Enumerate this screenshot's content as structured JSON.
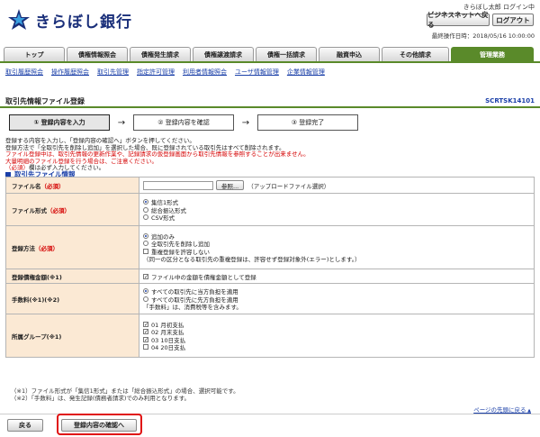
{
  "header": {
    "bank_name": "きらぼし銀行",
    "user_status": "きらぼし太郎 ログイン中",
    "biz_net_button": "ビジネスネットへ戻る",
    "logout_button": "ログアウト",
    "last_operation": "最終操作日時：2018/05/16 10:00:00",
    "brand_color": "#1a2f7a",
    "accent_color": "#5a8a2a"
  },
  "tabs": [
    {
      "label": "トップ",
      "w": 68
    },
    {
      "label": "債権情報照会",
      "w": 68
    },
    {
      "label": "債権発生請求",
      "w": 68
    },
    {
      "label": "債権譲渡請求",
      "w": 68
    },
    {
      "label": "債権一括請求",
      "w": 68
    },
    {
      "label": "融資申込",
      "w": 68
    },
    {
      "label": "その他請求",
      "w": 75
    },
    {
      "label": "管理業務",
      "w": 92,
      "active": true
    }
  ],
  "subnav": [
    "取引履歴照会",
    "操作履歴照会",
    "取引先管理",
    "指定許可管理",
    "利用者情報照会",
    "ユーザ情報管理",
    "企業情報管理"
  ],
  "page": {
    "title": "取引先情報ファイル登録",
    "screen_code": "SCRTSK14101"
  },
  "steps": [
    {
      "label": "① 登録内容を入力",
      "w": 112,
      "active": true
    },
    {
      "label": "② 登録内容を確認",
      "w": 112
    },
    {
      "label": "③ 登録完了",
      "w": 112
    }
  ],
  "instructions": {
    "line1": "登録する内容を入力し、「登録内容の確認へ」ボタンを押してください。",
    "line2": "登録方法で「全取引先を削除し追加」を選択した場合、既に登録されている取引先はすべて削除されます。",
    "line3": "ファイル登録中は、取引先情報の更新作業や、記録請求の仮登録画面から取引先情報を参照することが出来ません。",
    "line4": "大量明細のファイル登録を行う場合は、ご注意ください。",
    "line5": "（必須）欄は必ず入力してください。"
  },
  "section_title": "取引先ファイル情報",
  "form": {
    "file_name": {
      "label": "ファイル名",
      "required": "（必須）",
      "browse": "参照...",
      "hint": "（アップロードファイル選択）"
    },
    "file_format": {
      "label": "ファイル形式",
      "required": "（必須）",
      "options": [
        "集信1形式",
        "総合振込形式",
        "CSV形式"
      ]
    },
    "reg_method": {
      "label": "登録方法",
      "required": "（必須）",
      "options": [
        "追加のみ",
        "全取引先を削除し追加"
      ],
      "dup_label": "重複登録を許容しない",
      "dup_note": "（同一の区分となる取引先の重複登録は、許容せず登録対象外(エラー)とします。）"
    },
    "reg_amount": {
      "label": "登録債権金額(※1)",
      "check_label": "ファイル中の金額を債権金額として登録"
    },
    "fee": {
      "label": "手数料(※1)(※2)",
      "options": [
        "すべての取引先に当方負担を適用",
        "すべての取引先に先方負担を適用"
      ],
      "note": "「手数料」は、消費税等を含みます。"
    },
    "group": {
      "label": "所属グループ(※1)",
      "options": [
        "01 月初支払",
        "02 月末支払",
        "03 10日支払",
        "04 20日支払"
      ]
    }
  },
  "notes": {
    "n1": "（※1）ファイル形式が「集信1形式」または「総合振込形式」の場合、選択可能です。",
    "n2": "（※2）「手数料」は、発生記録(債務者請求)でのみ利用となります。"
  },
  "to_top": "ページの先頭に戻る",
  "footer": {
    "back": "戻る",
    "confirm": "登録内容の確認へ"
  }
}
